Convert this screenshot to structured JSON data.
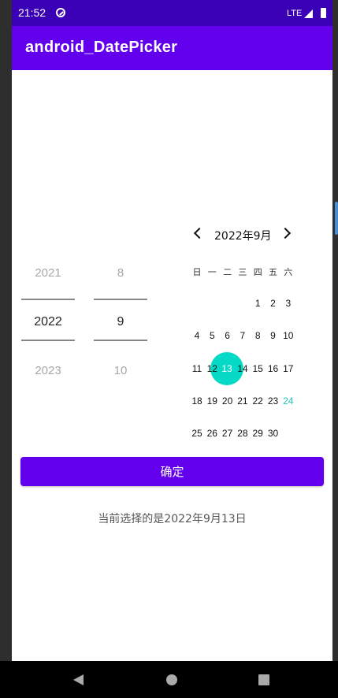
{
  "status_bar": {
    "time": "21:52",
    "network": "LTE"
  },
  "app_bar": {
    "title": "android_DatePicker"
  },
  "year_picker": {
    "prev": "2021",
    "selected": "2022",
    "next": "2023"
  },
  "month_picker": {
    "prev": "8",
    "selected": "9",
    "next": "10"
  },
  "calendar": {
    "title": "2022年9月",
    "weekdays": [
      "日",
      "一",
      "二",
      "三",
      "四",
      "五",
      "六"
    ],
    "selected_day": "13",
    "today_day": "24",
    "days": [
      "1",
      "2",
      "3",
      "4",
      "5",
      "6",
      "7",
      "8",
      "9",
      "10",
      "11",
      "12",
      "13",
      "14",
      "15",
      "16",
      "17",
      "18",
      "19",
      "20",
      "21",
      "22",
      "23",
      "24",
      "25",
      "26",
      "27",
      "28",
      "29",
      "30"
    ]
  },
  "confirm_button": {
    "label": "确定"
  },
  "result_text": "当前选择的是2022年9月13日",
  "colors": {
    "status_bar": "#3a00b5",
    "app_bar": "#6200ee",
    "selected_circle": "#07d9c7",
    "today_text": "#1ec5b6"
  }
}
